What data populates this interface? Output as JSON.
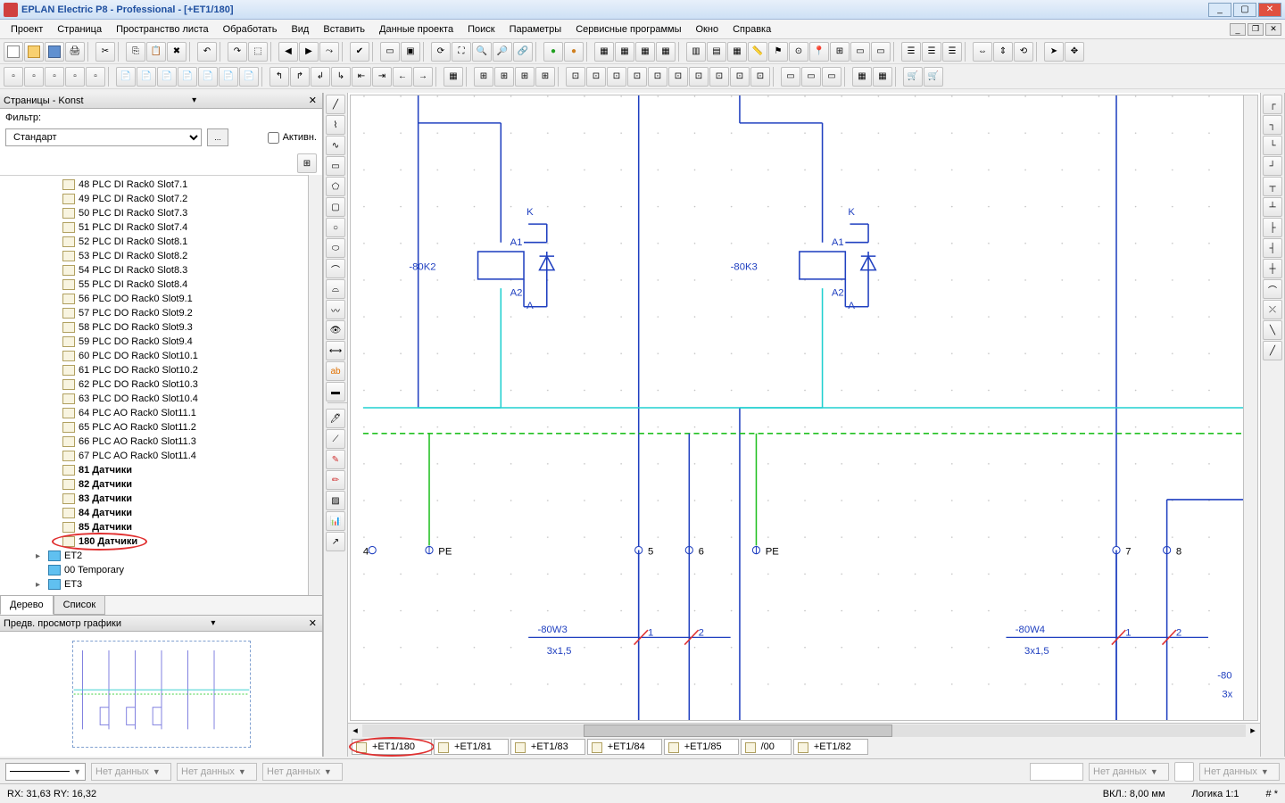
{
  "title": "EPLAN Electric P8 - Professional - [+ET1/180]",
  "menu": [
    "Проект",
    "Страница",
    "Пространство листа",
    "Обработать",
    "Вид",
    "Вставить",
    "Данные проекта",
    "Поиск",
    "Параметры",
    "Сервисные программы",
    "Окно",
    "Справка"
  ],
  "pages_panel": {
    "title": "Страницы - Konst",
    "filter_label": "Фильтр:",
    "filter_value": "Стандарт",
    "filter_btn": "...",
    "active_label": "Активн.",
    "tree": [
      {
        "label": "48 PLC DI Rack0 Slot7.1",
        "bold": false
      },
      {
        "label": "49 PLC DI Rack0 Slot7.2",
        "bold": false
      },
      {
        "label": "50 PLC DI Rack0 Slot7.3",
        "bold": false
      },
      {
        "label": "51 PLC DI Rack0 Slot7.4",
        "bold": false
      },
      {
        "label": "52 PLC DI Rack0 Slot8.1",
        "bold": false
      },
      {
        "label": "53 PLC DI Rack0 Slot8.2",
        "bold": false
      },
      {
        "label": "54 PLC DI Rack0 Slot8.3",
        "bold": false
      },
      {
        "label": "55 PLC DI Rack0 Slot8.4",
        "bold": false
      },
      {
        "label": "56 PLC DO Rack0 Slot9.1",
        "bold": false
      },
      {
        "label": "57 PLC DO Rack0 Slot9.2",
        "bold": false
      },
      {
        "label": "58 PLC DO Rack0 Slot9.3",
        "bold": false
      },
      {
        "label": "59 PLC DO Rack0 Slot9.4",
        "bold": false
      },
      {
        "label": "60 PLC DO Rack0 Slot10.1",
        "bold": false
      },
      {
        "label": "61 PLC DO Rack0 Slot10.2",
        "bold": false
      },
      {
        "label": "62 PLC DO Rack0 Slot10.3",
        "bold": false
      },
      {
        "label": "63 PLC DO Rack0 Slot10.4",
        "bold": false
      },
      {
        "label": "64 PLC AO Rack0 Slot11.1",
        "bold": false
      },
      {
        "label": "65 PLC AO Rack0 Slot11.2",
        "bold": false
      },
      {
        "label": "66 PLC AO Rack0 Slot11.3",
        "bold": false
      },
      {
        "label": "67 PLC AO Rack0 Slot11.4",
        "bold": false
      },
      {
        "label": "81 Датчики",
        "bold": true
      },
      {
        "label": "82 Датчики",
        "bold": true
      },
      {
        "label": "83 Датчики",
        "bold": true
      },
      {
        "label": "84 Датчики",
        "bold": true
      },
      {
        "label": "85 Датчики",
        "bold": true
      },
      {
        "label": "180 Датчики",
        "bold": true,
        "selected": true
      }
    ],
    "nodes": [
      {
        "label": "ET2",
        "exp": "▸"
      },
      {
        "label": "00 Temporary",
        "exp": ""
      },
      {
        "label": "ET3",
        "exp": "▸"
      }
    ],
    "tabs": [
      "Дерево",
      "Список"
    ],
    "active_tab": 0
  },
  "preview_panel": {
    "title": "Предв. просмотр графики"
  },
  "page_tabs": [
    "+ET1/180",
    "+ET1/81",
    "+ET1/83",
    "+ET1/84",
    "+ET1/85",
    "/00",
    "+ET1/82"
  ],
  "active_page_tab": 0,
  "schematic": {
    "relay1": {
      "tag": "-80K2",
      "k": "K",
      "a1": "A1",
      "a2": "A2",
      "a": "A"
    },
    "relay2": {
      "tag": "-80K3",
      "k": "K",
      "a1": "A1",
      "a2": "A2",
      "a": "A"
    },
    "terms": {
      "t4": "4",
      "pe1": "PE",
      "t5": "5",
      "t6": "6",
      "pe2": "PE",
      "t7": "7",
      "t8": "8"
    },
    "cable1": {
      "tag": "-80W3",
      "spec": "3x1,5",
      "c1": "1",
      "c2": "2"
    },
    "cable2": {
      "tag": "-80W4",
      "spec": "3x1,5",
      "c1": "1",
      "c2": "2"
    },
    "cable3": {
      "tag": "-80",
      "spec": "3x"
    }
  },
  "bottom": {
    "nodata": "Нет данных"
  },
  "status": {
    "coords": "RX: 31,63    RY: 16,32",
    "vkl": "ВКЛ.: 8,00 мм",
    "logic": "Логика 1:1",
    "extra": "# *"
  }
}
